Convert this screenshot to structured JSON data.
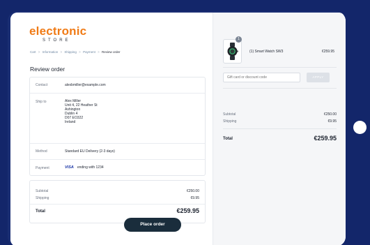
{
  "brand": {
    "name_top": "electronic",
    "name_bottom": "STORE",
    "accent_color": "#f07b16"
  },
  "breadcrumb": {
    "items": [
      "Cart",
      "Information",
      "Shipping",
      "Payment",
      "Review order"
    ],
    "separator": ">"
  },
  "page": {
    "title": "Review order"
  },
  "review": {
    "contact_label": "Contact",
    "contact_value": "alexbmiller@example.com",
    "shipto_label": "Ship to",
    "shipto_lines": [
      "Alex Miller",
      "Unit 4, 22 Heather St",
      "Ashington",
      "Dublin 4",
      "D07 EO322",
      "Ireland"
    ],
    "method_label": "Method",
    "method_value": "Standard EU Delivery (2-3 days)",
    "payment_label": "Payment",
    "payment_brand": "VISA",
    "payment_value": "ending with 1234"
  },
  "totals": {
    "subtotal_label": "Subtotal",
    "subtotal_value": "€250.00",
    "shipping_label": "Shipping",
    "shipping_value": "€9.95",
    "total_label": "Total",
    "total_value": "€259.95"
  },
  "actions": {
    "place_order": "Place order"
  },
  "summary": {
    "product_qty": "1",
    "product_name": "(1) Smart Watch SW3",
    "product_price": "€259.95",
    "discount_placeholder": "Gift card or discount code",
    "apply_label": "APPLY",
    "subtotal_label": "Subtotal",
    "subtotal_value": "€250.00",
    "shipping_label": "Shipping",
    "shipping_value": "€9.95",
    "total_label": "Total",
    "total_value": "€259.95"
  },
  "icons": {
    "product": "smartwatch-icon",
    "payment": "visa-icon"
  },
  "colors": {
    "device_frame": "#13266a",
    "button_dark": "#1a2d3c",
    "summary_bg": "#f5f6f8"
  }
}
